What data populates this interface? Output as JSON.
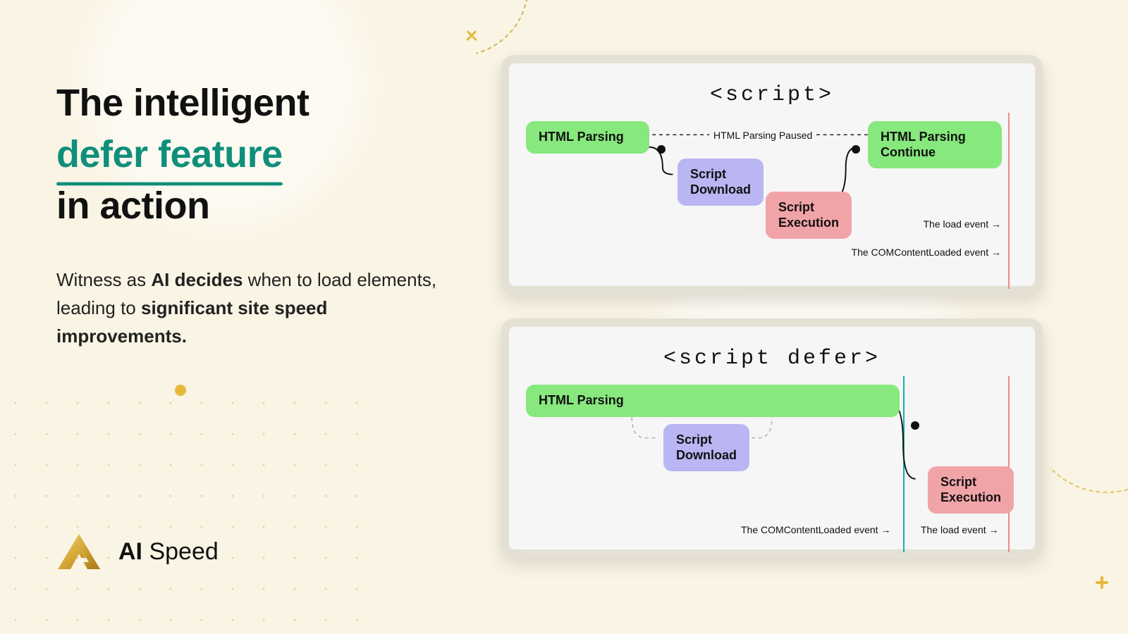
{
  "headline": {
    "line1": "The intelligent",
    "highlight": "defer feature",
    "line2": "in action"
  },
  "subtext": {
    "before": "Witness as ",
    "bold1": "AI decides",
    "mid": " when to load elements, leading to ",
    "bold2": "significant site speed improvements."
  },
  "brand": {
    "bold": "AI",
    "rest": " Speed"
  },
  "cards": {
    "script": {
      "title": "<script>",
      "html_parsing": "HTML Parsing",
      "paused": "HTML Parsing Paused",
      "script_download": "Script\nDownload",
      "script_execution": "Script\nExecution",
      "html_parsing_continue": "HTML Parsing\nContinue",
      "load_event": "The load event",
      "dom_event": "The COMContentLoaded event"
    },
    "defer": {
      "title": "<script defer>",
      "html_parsing": "HTML Parsing",
      "script_download": "Script\nDownload",
      "script_execution": "Script\nExecution",
      "dom_event": "The COMContentLoaded event",
      "load_event": "The load event"
    }
  }
}
